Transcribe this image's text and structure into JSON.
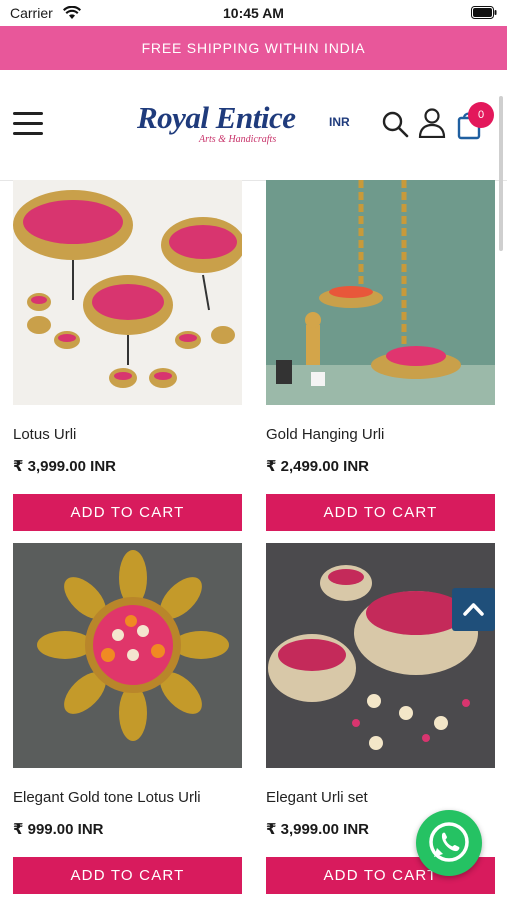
{
  "status_bar": {
    "carrier": "Carrier",
    "time": "10:45 AM"
  },
  "promo": {
    "text": "FREE SHIPPING WITHIN INDIA"
  },
  "header": {
    "logo_text": "Royal Entice",
    "logo_currency": "INR",
    "logo_tagline": "Arts & Handicrafts",
    "cart_count": "0"
  },
  "colors": {
    "accent": "#d81b5d",
    "banner": "#e8579a",
    "brand_blue": "#1f3b7c",
    "whatsapp": "#25c263"
  },
  "products": [
    {
      "name": "Lotus Urli",
      "price": "₹ 3,999.00 INR",
      "button": "ADD TO CART"
    },
    {
      "name": "Gold Hanging Urli",
      "price": "₹ 2,499.00 INR",
      "button": "ADD TO CART"
    },
    {
      "name": "Elegant Gold tone Lotus Urli",
      "price": "₹ 999.00 INR",
      "button": "ADD TO CART"
    },
    {
      "name": "Elegant Urli set",
      "price": "₹ 3,999.00 INR",
      "button": "ADD TO CART"
    }
  ],
  "icons": [
    "menu-icon",
    "search-icon",
    "user-icon",
    "cart-icon",
    "chevron-up-icon",
    "whatsapp-icon"
  ]
}
